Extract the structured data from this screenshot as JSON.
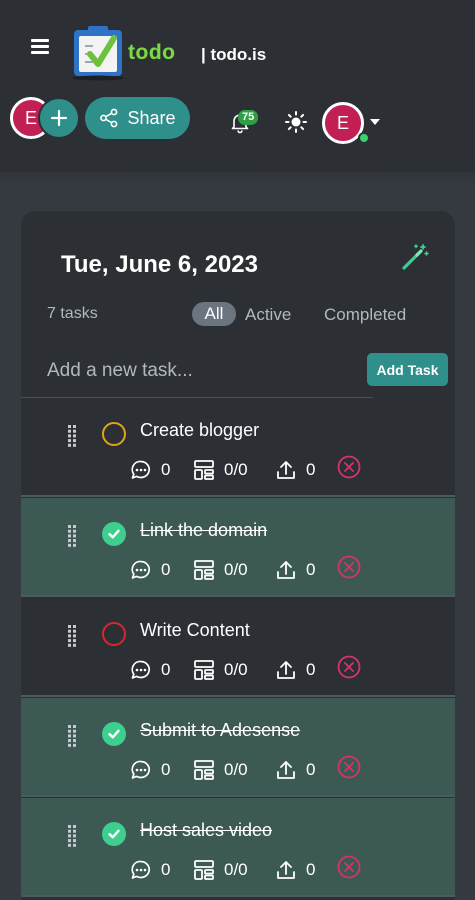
{
  "header": {
    "logo_text": "todo",
    "site_name": "| todo.is",
    "avatar_initial": "E",
    "share_label": "Share",
    "notification_count": "75",
    "user_initial": "E"
  },
  "card": {
    "date": "Tue, June 6, 2023",
    "task_count": "7 tasks",
    "filters": {
      "all": "All",
      "active": "Active",
      "completed": "Completed"
    },
    "input_placeholder": "Add a new task...",
    "add_button": "Add Task"
  },
  "tasks": [
    {
      "title": "Create blogger",
      "done": false,
      "status_color": "#e0a417",
      "comments": "0",
      "subtasks": "0/0",
      "attachments": "0"
    },
    {
      "title": "Link the domain",
      "done": true,
      "comments": "0",
      "subtasks": "0/0",
      "attachments": "0"
    },
    {
      "title": "Write Content",
      "done": false,
      "status_color": "#d9262e",
      "comments": "0",
      "subtasks": "0/0",
      "attachments": "0"
    },
    {
      "title": "Submit to Adesense",
      "done": true,
      "comments": "0",
      "subtasks": "0/0",
      "attachments": "0"
    },
    {
      "title": "Host sales video",
      "done": true,
      "comments": "0",
      "subtasks": "0/0",
      "attachments": "0"
    }
  ],
  "colors": {
    "accent": "#2f8f8a",
    "avatar": "#c21f55",
    "done_row": "#3c5a53",
    "check": "#3ecf8e",
    "delete": "#d6336c"
  }
}
